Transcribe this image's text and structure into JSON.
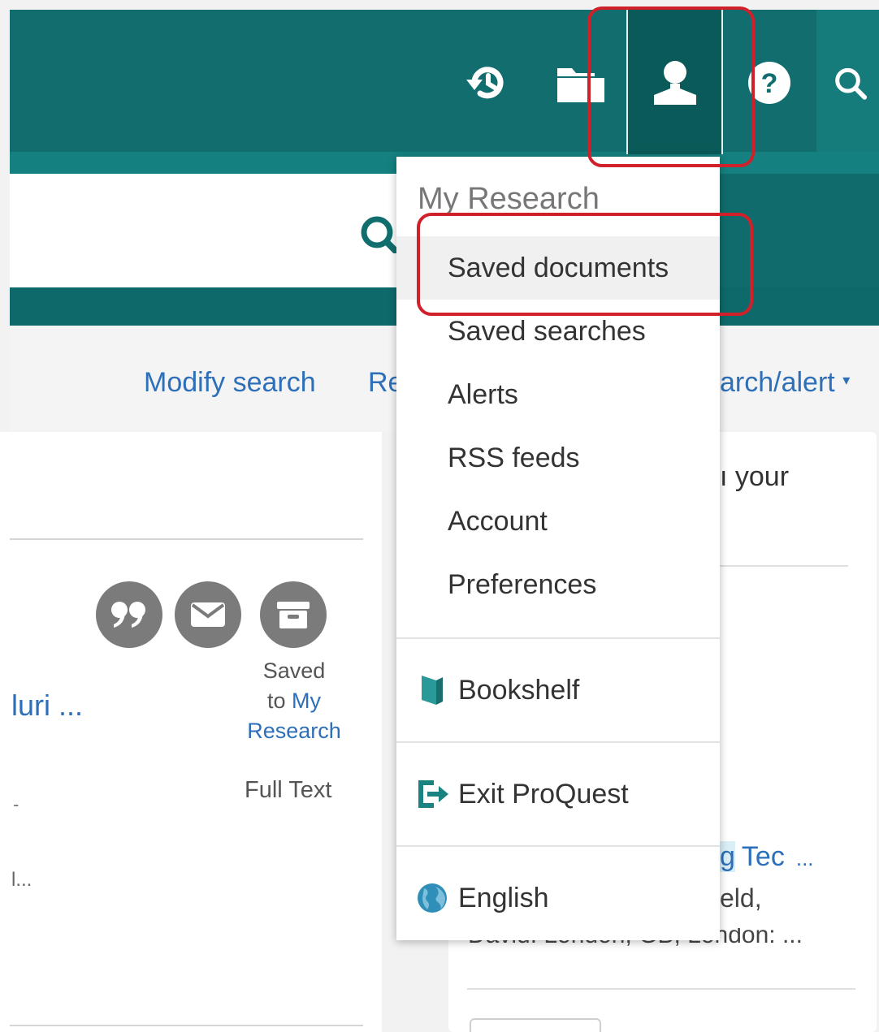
{
  "header": {
    "icons": {
      "history": "history-icon",
      "folder": "folder-icon",
      "user": "user-icon",
      "help": "help-icon",
      "search": "search-icon"
    },
    "help_glyph": "?"
  },
  "toolbar": {
    "modify_search": "Modify search",
    "recent_fragment": "Re",
    "alert_fragment": "arch/alert",
    "alert_caret": "▾"
  },
  "result_left": {
    "saved_prefix": "Saved",
    "saved_to": "to",
    "saved_link": "My Research",
    "title_fragment": "luri ...",
    "full_text": "Full Text",
    "dash_fragment": "-",
    "dots_fragment": "l..."
  },
  "result_right": {
    "your_fragment": "ı your",
    "title_highlight": "g",
    "title_word": "Tec",
    "title_ellipsis": "...",
    "author_fragment": "eld,",
    "location_fragment": "David. London, GB, London:  ..."
  },
  "my_research_menu": {
    "heading": "My Research",
    "items": [
      {
        "label": "Saved documents",
        "active": true
      },
      {
        "label": "Saved searches",
        "active": false
      },
      {
        "label": "Alerts",
        "active": false
      },
      {
        "label": "RSS feeds",
        "active": false
      },
      {
        "label": "Account",
        "active": false
      },
      {
        "label": "Preferences",
        "active": false
      }
    ],
    "bookshelf": {
      "label": "Bookshelf",
      "icon": "book-icon"
    },
    "exit": {
      "label": "Exit ProQuest",
      "icon": "exit-icon"
    },
    "language": {
      "label": "English",
      "icon": "globe-icon"
    }
  },
  "colors": {
    "header_teal": "#126e6e",
    "active_teal": "#0a5a59",
    "link_blue": "#2d6fb8",
    "highlight_red": "#d0202a",
    "icon_gray": "#7b7b7b"
  }
}
